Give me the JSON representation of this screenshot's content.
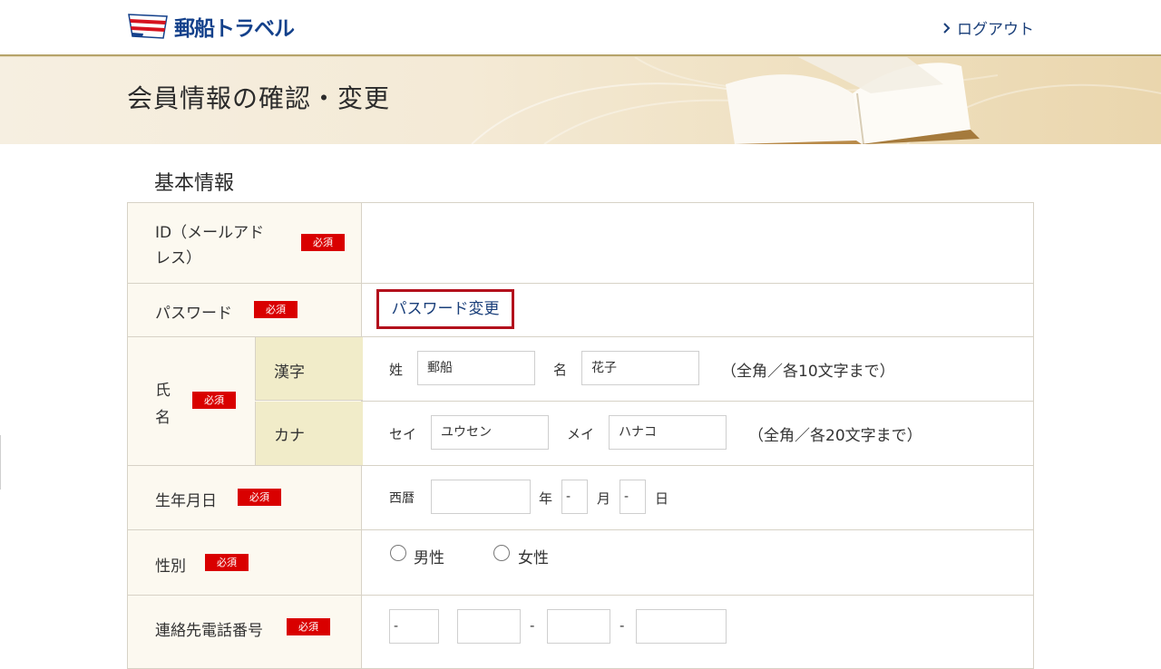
{
  "header": {
    "logo_text": "郵船トラベル",
    "logout_label": "ログアウト"
  },
  "banner": {
    "title": "会員情報の確認・変更"
  },
  "section": {
    "title": "基本情報"
  },
  "required_badge": "必須",
  "form": {
    "id": {
      "label_line1": "ID（メールアド",
      "label_line2": "レス）",
      "value": ""
    },
    "password": {
      "label": "パスワード",
      "link_label": "パスワード変更"
    },
    "name": {
      "label_line1": "氏",
      "label_line2": "名",
      "kanji": {
        "label": "漢字",
        "sei_label": "姓",
        "sei_value": "郵船",
        "mei_label": "名",
        "mei_value": "花子",
        "note": "（全角／各10文字まで）"
      },
      "kana": {
        "label": "カナ",
        "sei_label": "セイ",
        "sei_value": "ユウセン",
        "mei_label": "メイ",
        "mei_value": "ハナコ",
        "note": "（全角／各20文字まで）"
      }
    },
    "birthday": {
      "label": "生年月日",
      "era_label": "西暦",
      "year_value": "",
      "year_label": "年",
      "month_value": "-",
      "month_label": "月",
      "day_value": "-",
      "day_label": "日"
    },
    "gender": {
      "label": "性別",
      "male": "男性",
      "female": "女性"
    },
    "phone": {
      "label": "連絡先電話番号",
      "part1": "-",
      "part2": "",
      "part3": "",
      "part4": "",
      "sep": "-"
    }
  },
  "colors": {
    "required": "#d90000",
    "label_bg": "#fcf9f0",
    "sub_label_bg": "#f1ecc9",
    "link": "#1a3f7a",
    "highlight_border": "#b30f1c"
  }
}
